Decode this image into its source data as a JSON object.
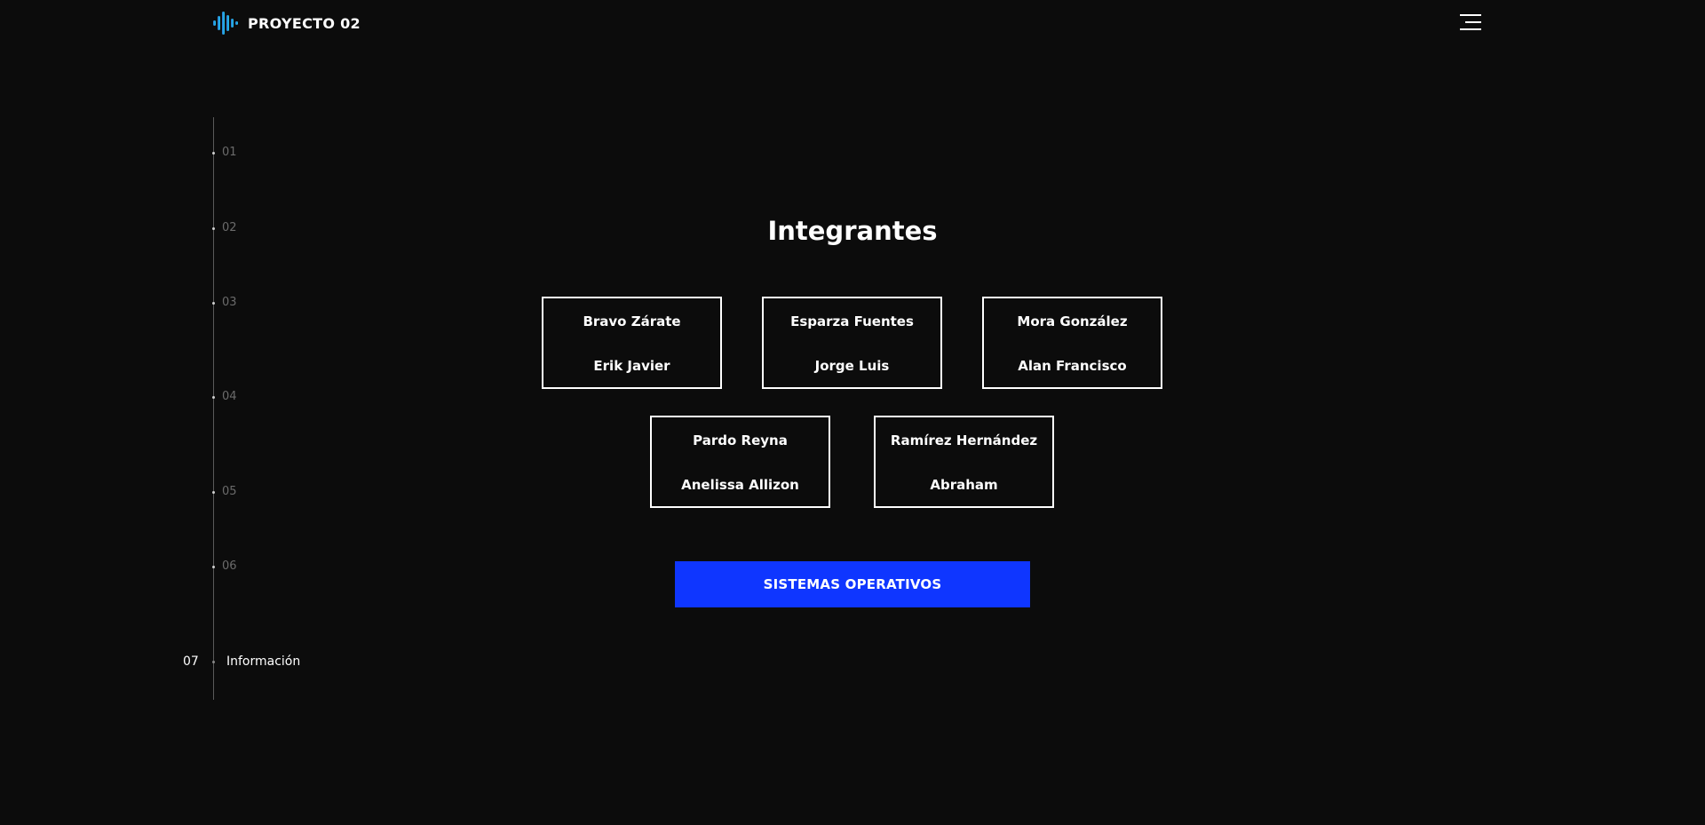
{
  "header": {
    "brand": "PROYECTO 02",
    "logo_icon": "soundwave-icon",
    "menu_icon": "hamburger-menu-icon"
  },
  "side_nav": {
    "items": [
      {
        "number": "01",
        "label": ""
      },
      {
        "number": "02",
        "label": ""
      },
      {
        "number": "03",
        "label": ""
      },
      {
        "number": "04",
        "label": ""
      },
      {
        "number": "05",
        "label": ""
      },
      {
        "number": "06",
        "label": ""
      },
      {
        "number": "07",
        "label": "Información",
        "active": true
      }
    ]
  },
  "main": {
    "title": "Integrantes",
    "members": [
      {
        "surname": "Bravo Zárate",
        "name": "Erik Javier"
      },
      {
        "surname": "Esparza Fuentes",
        "name": "Jorge Luis"
      },
      {
        "surname": "Mora González",
        "name": "Alan Francisco"
      },
      {
        "surname": "Pardo Reyna",
        "name": "Anelissa Allizon"
      },
      {
        "surname": "Ramírez Hernández",
        "name": "Abraham"
      }
    ],
    "cta_label": "SISTEMAS OPERATIVOS"
  },
  "colors": {
    "background": "#0c0c0c",
    "accent": "#0f36ff",
    "text": "#ffffff",
    "muted": "#6b6b6b"
  }
}
